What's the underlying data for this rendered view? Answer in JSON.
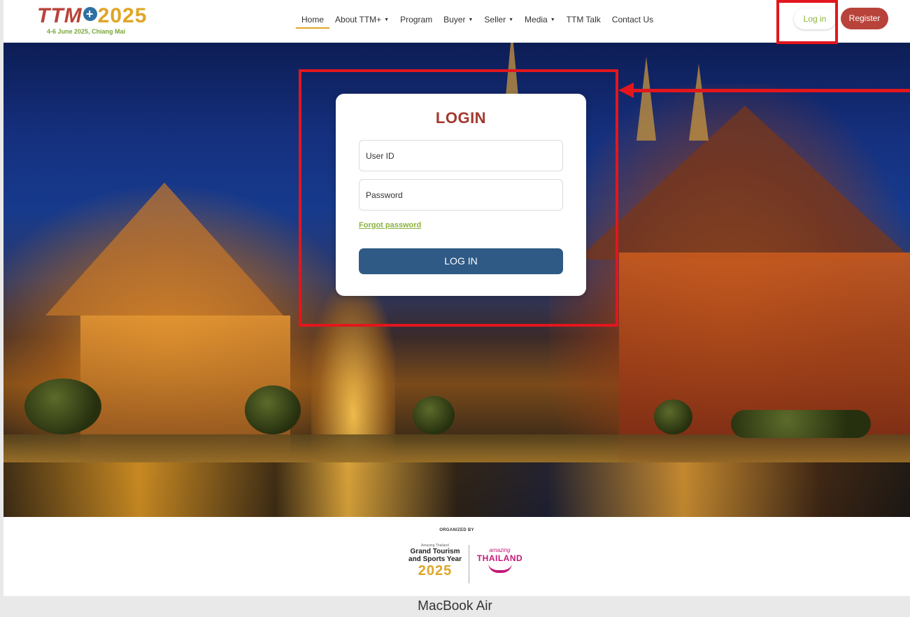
{
  "header": {
    "logo_text_ttm": "TTM",
    "logo_plus": "+",
    "logo_year": "2025",
    "logo_subtitle": "4-6 June 2025, Chiang Mai",
    "nav": [
      {
        "label": "Home",
        "active": true,
        "dropdown": false
      },
      {
        "label": "About TTM+",
        "active": false,
        "dropdown": true
      },
      {
        "label": "Program",
        "active": false,
        "dropdown": false
      },
      {
        "label": "Buyer",
        "active": false,
        "dropdown": true
      },
      {
        "label": "Seller",
        "active": false,
        "dropdown": true
      },
      {
        "label": "Media",
        "active": false,
        "dropdown": true
      },
      {
        "label": "TTM Talk",
        "active": false,
        "dropdown": false
      },
      {
        "label": "Contact Us",
        "active": false,
        "dropdown": false
      }
    ],
    "caret": "▼",
    "login_label": "Log in",
    "register_label": "Register"
  },
  "login_card": {
    "title": "LOGIN",
    "user_placeholder": "User ID",
    "password_placeholder": "Password",
    "forgot_label": "Forgot password",
    "submit_label": "LOG IN"
  },
  "footer": {
    "organized_by": "ORGANIZED BY",
    "gt_small": "Amazing Thailand",
    "gt_line1": "Grand Tourism",
    "gt_line2": "and Sports Year",
    "gt_year": "2025",
    "th_small": "amazing",
    "th_main": "THAILAND"
  },
  "device_label": "MacBook Air",
  "colors": {
    "brand_red": "#b8433a",
    "brand_green": "#8bb23d",
    "brand_gold": "#e0a526",
    "button_blue": "#2e5a85",
    "annotation_red": "#e2161d"
  }
}
